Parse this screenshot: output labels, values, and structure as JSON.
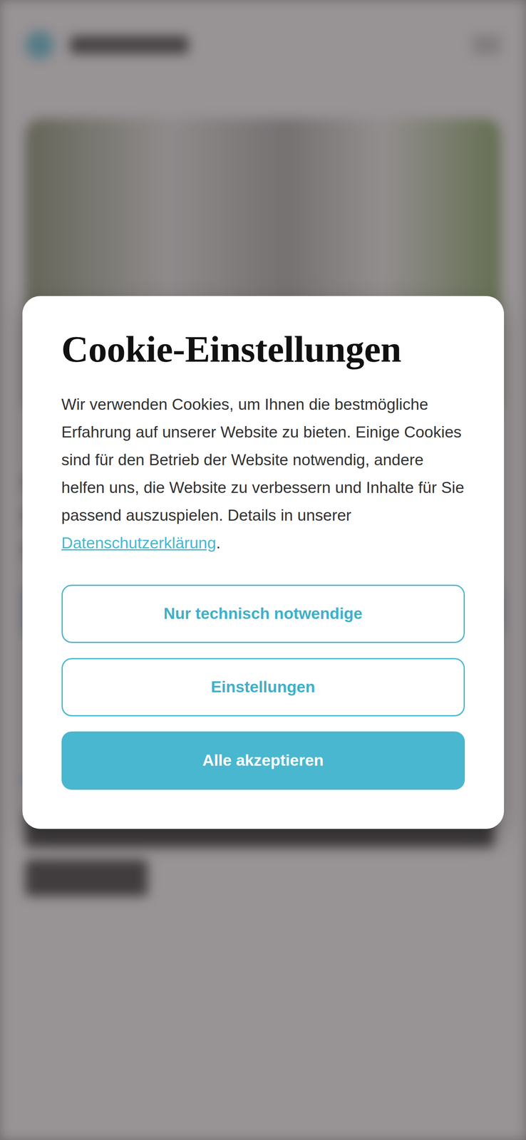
{
  "dialog": {
    "title": "Cookie-Einstellungen",
    "text": "Wir verwenden Cookies, um Ihnen die bestmögliche Erfahrung auf unserer Website zu bieten. Einige Cookies sind für den Betrieb der Website notwendig, andere helfen uns, die Website zu verbessern und Inhalte für Sie passend auszuspielen. Details in unserer ",
    "link": "Datenschutzerklärung",
    "text_end": ".",
    "buttons": [
      {
        "label": "Nur technisch notwendige",
        "kind": "outline"
      },
      {
        "label": "Einstellungen",
        "kind": "outline"
      },
      {
        "label": "Alle akzeptieren",
        "kind": "primary"
      }
    ]
  }
}
